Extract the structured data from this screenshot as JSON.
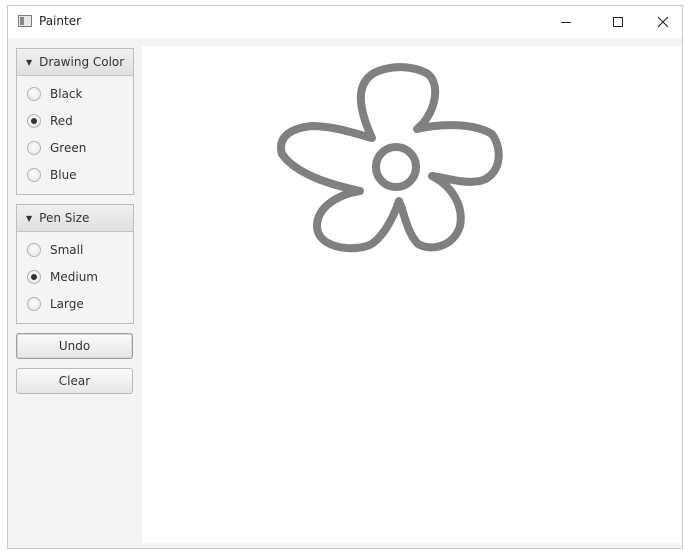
{
  "window": {
    "title": "Painter",
    "app_icon": "window-app-icon"
  },
  "drawing_color": {
    "title": "Drawing Color",
    "options": [
      "Black",
      "Red",
      "Green",
      "Blue"
    ],
    "selected": "Red"
  },
  "pen_size": {
    "title": "Pen Size",
    "options": [
      "Small",
      "Medium",
      "Large"
    ],
    "selected": "Medium"
  },
  "buttons": {
    "undo": "Undo",
    "clear": "Clear"
  },
  "canvas": {
    "stroke_color": "#808080",
    "content": "flower doodle"
  }
}
